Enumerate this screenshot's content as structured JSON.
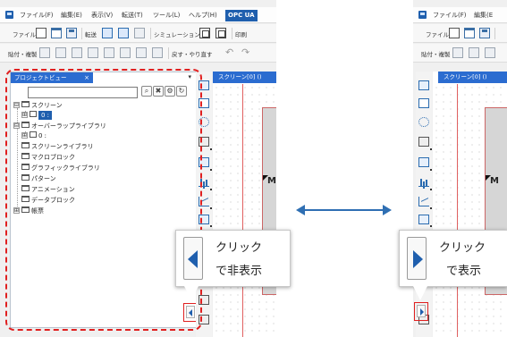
{
  "menu": {
    "file": "ファイル(F)",
    "edit": "編集(E)",
    "view": "表示(V)",
    "transfer": "転送(T)",
    "tool": "ツール(L)",
    "help": "ヘルプ(H)",
    "opcua": "OPC UA"
  },
  "toolbar1": {
    "file_label": "ファイル",
    "transfer_label": "転送",
    "simulation_label": "シミュレーション",
    "print_label": "印刷"
  },
  "toolbar2": {
    "paste_label": "貼付・複製",
    "undo_label": "戻す・やり直す"
  },
  "panel": {
    "tab_title": "プロジェクトビュー",
    "close_symbol": "×",
    "dropdown_symbol": "▾",
    "search_value": "",
    "search_buttons": [
      "⌕",
      "✖",
      "⚙",
      "↻"
    ]
  },
  "tree": [
    {
      "label": "スクリーン",
      "expander": "⊟"
    },
    {
      "label": "0 :",
      "expander": "⊞",
      "selected": true
    },
    {
      "label": "オーバーラップライブラリ",
      "expander": "⊟"
    },
    {
      "label": "0 :",
      "expander": "⊞"
    },
    {
      "label": "スクリーンライブラリ"
    },
    {
      "label": "マクロブロック"
    },
    {
      "label": "グラフィックライブラリ"
    },
    {
      "label": "パターン"
    },
    {
      "label": "アニメーション"
    },
    {
      "label": "データブロック"
    },
    {
      "label": "帳票",
      "expander": "⊞"
    }
  ],
  "screen_tab": "スクリーン[0] ()",
  "canvas_mark": "M",
  "callout_left": {
    "line1": "クリック",
    "line2": "で非表示"
  },
  "callout_right": {
    "line1": "クリック",
    "line2": "で表示"
  },
  "right_menu": {
    "file": "ファイル(F)",
    "edit": "編集(E"
  },
  "right_toolbar1": {
    "file_label": "ファイル"
  },
  "right_toolbar2": {
    "paste_label": "貼付・複製"
  },
  "right_screen_tab": "スクリーン[0] ()",
  "colors": {
    "accent_blue": "#1f5fae",
    "highlight_red": "#e02020",
    "arrow_blue": "#2f6fb3"
  }
}
